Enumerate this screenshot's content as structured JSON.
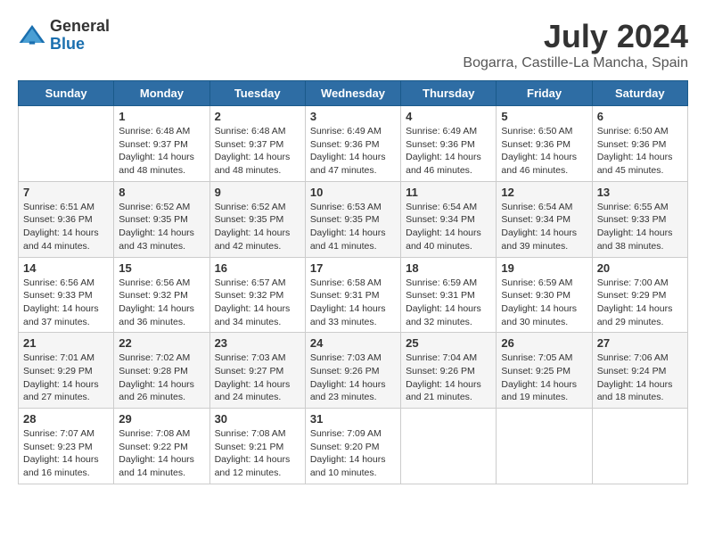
{
  "header": {
    "logo_general": "General",
    "logo_blue": "Blue",
    "month_year": "July 2024",
    "location": "Bogarra, Castille-La Mancha, Spain"
  },
  "days_of_week": [
    "Sunday",
    "Monday",
    "Tuesday",
    "Wednesday",
    "Thursday",
    "Friday",
    "Saturday"
  ],
  "weeks": [
    [
      {
        "date": "",
        "content": ""
      },
      {
        "date": "1",
        "content": "Sunrise: 6:48 AM\nSunset: 9:37 PM\nDaylight: 14 hours\nand 48 minutes."
      },
      {
        "date": "2",
        "content": "Sunrise: 6:48 AM\nSunset: 9:37 PM\nDaylight: 14 hours\nand 48 minutes."
      },
      {
        "date": "3",
        "content": "Sunrise: 6:49 AM\nSunset: 9:36 PM\nDaylight: 14 hours\nand 47 minutes."
      },
      {
        "date": "4",
        "content": "Sunrise: 6:49 AM\nSunset: 9:36 PM\nDaylight: 14 hours\nand 46 minutes."
      },
      {
        "date": "5",
        "content": "Sunrise: 6:50 AM\nSunset: 9:36 PM\nDaylight: 14 hours\nand 46 minutes."
      },
      {
        "date": "6",
        "content": "Sunrise: 6:50 AM\nSunset: 9:36 PM\nDaylight: 14 hours\nand 45 minutes."
      }
    ],
    [
      {
        "date": "7",
        "content": "Sunrise: 6:51 AM\nSunset: 9:36 PM\nDaylight: 14 hours\nand 44 minutes."
      },
      {
        "date": "8",
        "content": "Sunrise: 6:52 AM\nSunset: 9:35 PM\nDaylight: 14 hours\nand 43 minutes."
      },
      {
        "date": "9",
        "content": "Sunrise: 6:52 AM\nSunset: 9:35 PM\nDaylight: 14 hours\nand 42 minutes."
      },
      {
        "date": "10",
        "content": "Sunrise: 6:53 AM\nSunset: 9:35 PM\nDaylight: 14 hours\nand 41 minutes."
      },
      {
        "date": "11",
        "content": "Sunrise: 6:54 AM\nSunset: 9:34 PM\nDaylight: 14 hours\nand 40 minutes."
      },
      {
        "date": "12",
        "content": "Sunrise: 6:54 AM\nSunset: 9:34 PM\nDaylight: 14 hours\nand 39 minutes."
      },
      {
        "date": "13",
        "content": "Sunrise: 6:55 AM\nSunset: 9:33 PM\nDaylight: 14 hours\nand 38 minutes."
      }
    ],
    [
      {
        "date": "14",
        "content": "Sunrise: 6:56 AM\nSunset: 9:33 PM\nDaylight: 14 hours\nand 37 minutes."
      },
      {
        "date": "15",
        "content": "Sunrise: 6:56 AM\nSunset: 9:32 PM\nDaylight: 14 hours\nand 36 minutes."
      },
      {
        "date": "16",
        "content": "Sunrise: 6:57 AM\nSunset: 9:32 PM\nDaylight: 14 hours\nand 34 minutes."
      },
      {
        "date": "17",
        "content": "Sunrise: 6:58 AM\nSunset: 9:31 PM\nDaylight: 14 hours\nand 33 minutes."
      },
      {
        "date": "18",
        "content": "Sunrise: 6:59 AM\nSunset: 9:31 PM\nDaylight: 14 hours\nand 32 minutes."
      },
      {
        "date": "19",
        "content": "Sunrise: 6:59 AM\nSunset: 9:30 PM\nDaylight: 14 hours\nand 30 minutes."
      },
      {
        "date": "20",
        "content": "Sunrise: 7:00 AM\nSunset: 9:29 PM\nDaylight: 14 hours\nand 29 minutes."
      }
    ],
    [
      {
        "date": "21",
        "content": "Sunrise: 7:01 AM\nSunset: 9:29 PM\nDaylight: 14 hours\nand 27 minutes."
      },
      {
        "date": "22",
        "content": "Sunrise: 7:02 AM\nSunset: 9:28 PM\nDaylight: 14 hours\nand 26 minutes."
      },
      {
        "date": "23",
        "content": "Sunrise: 7:03 AM\nSunset: 9:27 PM\nDaylight: 14 hours\nand 24 minutes."
      },
      {
        "date": "24",
        "content": "Sunrise: 7:03 AM\nSunset: 9:26 PM\nDaylight: 14 hours\nand 23 minutes."
      },
      {
        "date": "25",
        "content": "Sunrise: 7:04 AM\nSunset: 9:26 PM\nDaylight: 14 hours\nand 21 minutes."
      },
      {
        "date": "26",
        "content": "Sunrise: 7:05 AM\nSunset: 9:25 PM\nDaylight: 14 hours\nand 19 minutes."
      },
      {
        "date": "27",
        "content": "Sunrise: 7:06 AM\nSunset: 9:24 PM\nDaylight: 14 hours\nand 18 minutes."
      }
    ],
    [
      {
        "date": "28",
        "content": "Sunrise: 7:07 AM\nSunset: 9:23 PM\nDaylight: 14 hours\nand 16 minutes."
      },
      {
        "date": "29",
        "content": "Sunrise: 7:08 AM\nSunset: 9:22 PM\nDaylight: 14 hours\nand 14 minutes."
      },
      {
        "date": "30",
        "content": "Sunrise: 7:08 AM\nSunset: 9:21 PM\nDaylight: 14 hours\nand 12 minutes."
      },
      {
        "date": "31",
        "content": "Sunrise: 7:09 AM\nSunset: 9:20 PM\nDaylight: 14 hours\nand 10 minutes."
      },
      {
        "date": "",
        "content": ""
      },
      {
        "date": "",
        "content": ""
      },
      {
        "date": "",
        "content": ""
      }
    ]
  ]
}
